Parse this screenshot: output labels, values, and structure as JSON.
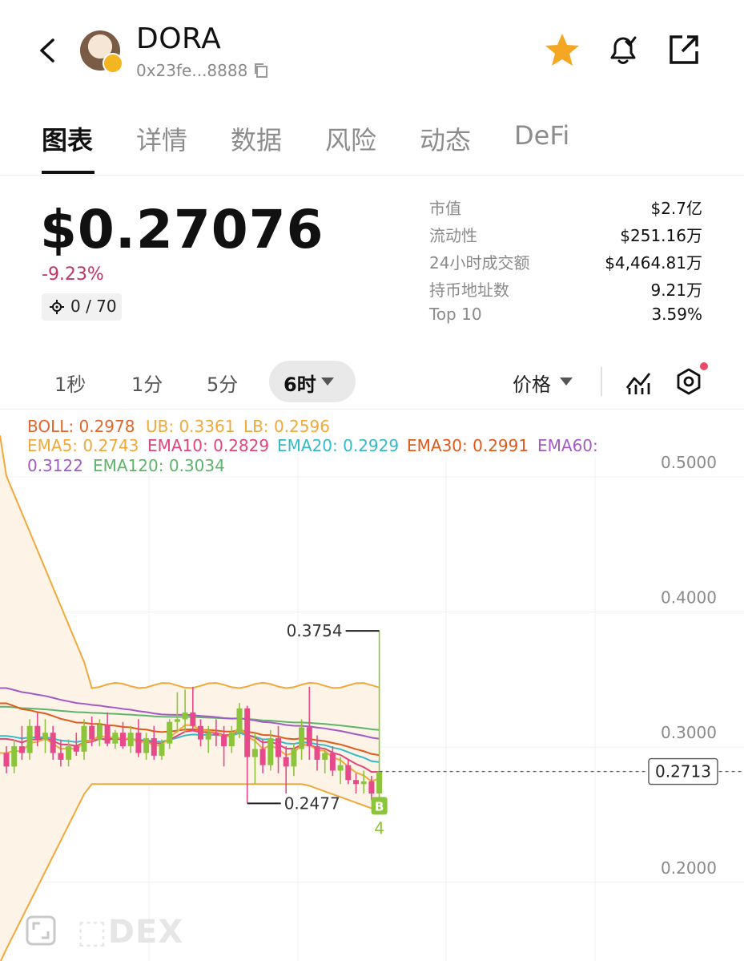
{
  "header": {
    "token_name": "DORA",
    "token_address": "0x23fe...8888",
    "icons": [
      "back-icon",
      "copy-icon",
      "star-icon",
      "bell-icon",
      "share-icon"
    ],
    "star_color": "#f5a623"
  },
  "tabs": [
    {
      "label": "图表",
      "active": true
    },
    {
      "label": "详情"
    },
    {
      "label": "数据"
    },
    {
      "label": "风险"
    },
    {
      "label": "动态"
    },
    {
      "label": "DeFi"
    }
  ],
  "price": {
    "value": "$0.27076",
    "change": "-9.23%",
    "change_color": "#c33362",
    "holders": "0 / 70"
  },
  "stats": [
    {
      "label": "市值",
      "value": "$2.7亿"
    },
    {
      "label": "流动性",
      "value": "$251.16万"
    },
    {
      "label": "24小时成交额",
      "value": "$4,464.81万"
    },
    {
      "label": "持币地址数",
      "value": "9.21万"
    },
    {
      "label": "Top 10",
      "value": "3.59%"
    }
  ],
  "intervals": [
    {
      "label": "1秒"
    },
    {
      "label": "1分"
    },
    {
      "label": "5分"
    },
    {
      "label": "6时",
      "active": true
    }
  ],
  "price_mode": "价格",
  "legend": {
    "boll": "BOLL: 0.2978",
    "ub": "UB: 0.3361",
    "lb": "LB: 0.2596",
    "ema5": "EMA5: 0.2743",
    "ema10": "EMA10: 0.2829",
    "ema20": "EMA20: 0.2929",
    "ema30": "EMA30: 0.2991",
    "ema60_label": "EMA60:",
    "ema60_value": "0.3122",
    "ema120": "EMA120: 0.3034",
    "colors": {
      "boll": "#e0662a",
      "ub": "#f0a93a",
      "lb": "#f0a93a",
      "ema5": "#f0a93a",
      "ema10": "#e0457a",
      "ema20": "#36b9c9",
      "ema30": "#e05a1a",
      "ema60": "#a35bc4",
      "ema120": "#5db56a"
    }
  },
  "chart_data": {
    "type": "candlestick",
    "y_ticks": [
      "0.5000",
      "0.4000",
      "0.3000",
      "0.2000"
    ],
    "ylim": [
      0.18,
      0.52
    ],
    "current_price": "0.2713",
    "high_marker": "0.3754",
    "low_marker": "0.2477",
    "signal_badge": "B",
    "signal_count": "4",
    "candles": [
      {
        "o": 0.285,
        "h": 0.29,
        "l": 0.27,
        "c": 0.275
      },
      {
        "o": 0.275,
        "h": 0.295,
        "l": 0.27,
        "c": 0.29
      },
      {
        "o": 0.29,
        "h": 0.305,
        "l": 0.28,
        "c": 0.285
      },
      {
        "o": 0.285,
        "h": 0.31,
        "l": 0.28,
        "c": 0.305
      },
      {
        "o": 0.305,
        "h": 0.315,
        "l": 0.29,
        "c": 0.295
      },
      {
        "o": 0.295,
        "h": 0.31,
        "l": 0.285,
        "c": 0.3
      },
      {
        "o": 0.3,
        "h": 0.305,
        "l": 0.28,
        "c": 0.285
      },
      {
        "o": 0.285,
        "h": 0.295,
        "l": 0.275,
        "c": 0.28
      },
      {
        "o": 0.28,
        "h": 0.295,
        "l": 0.275,
        "c": 0.29
      },
      {
        "o": 0.29,
        "h": 0.3,
        "l": 0.283,
        "c": 0.286
      },
      {
        "o": 0.286,
        "h": 0.31,
        "l": 0.28,
        "c": 0.305
      },
      {
        "o": 0.305,
        "h": 0.312,
        "l": 0.29,
        "c": 0.295
      },
      {
        "o": 0.295,
        "h": 0.31,
        "l": 0.29,
        "c": 0.306
      },
      {
        "o": 0.306,
        "h": 0.315,
        "l": 0.29,
        "c": 0.292
      },
      {
        "o": 0.292,
        "h": 0.302,
        "l": 0.288,
        "c": 0.3
      },
      {
        "o": 0.3,
        "h": 0.308,
        "l": 0.288,
        "c": 0.29
      },
      {
        "o": 0.29,
        "h": 0.305,
        "l": 0.285,
        "c": 0.3
      },
      {
        "o": 0.3,
        "h": 0.31,
        "l": 0.282,
        "c": 0.285
      },
      {
        "o": 0.285,
        "h": 0.3,
        "l": 0.28,
        "c": 0.296
      },
      {
        "o": 0.296,
        "h": 0.305,
        "l": 0.28,
        "c": 0.283
      },
      {
        "o": 0.283,
        "h": 0.295,
        "l": 0.28,
        "c": 0.292
      },
      {
        "o": 0.292,
        "h": 0.31,
        "l": 0.288,
        "c": 0.308
      },
      {
        "o": 0.308,
        "h": 0.33,
        "l": 0.3,
        "c": 0.31
      },
      {
        "o": 0.31,
        "h": 0.332,
        "l": 0.3,
        "c": 0.315
      },
      {
        "o": 0.315,
        "h": 0.334,
        "l": 0.302,
        "c": 0.305
      },
      {
        "o": 0.305,
        "h": 0.31,
        "l": 0.29,
        "c": 0.295
      },
      {
        "o": 0.295,
        "h": 0.305,
        "l": 0.285,
        "c": 0.3
      },
      {
        "o": 0.3,
        "h": 0.31,
        "l": 0.29,
        "c": 0.298
      },
      {
        "o": 0.298,
        "h": 0.305,
        "l": 0.275,
        "c": 0.29
      },
      {
        "o": 0.29,
        "h": 0.305,
        "l": 0.285,
        "c": 0.3
      },
      {
        "o": 0.3,
        "h": 0.322,
        "l": 0.296,
        "c": 0.318
      },
      {
        "o": 0.318,
        "h": 0.32,
        "l": 0.248,
        "c": 0.282
      },
      {
        "o": 0.282,
        "h": 0.3,
        "l": 0.262,
        "c": 0.288
      },
      {
        "o": 0.288,
        "h": 0.295,
        "l": 0.27,
        "c": 0.276
      },
      {
        "o": 0.276,
        "h": 0.302,
        "l": 0.272,
        "c": 0.296
      },
      {
        "o": 0.296,
        "h": 0.305,
        "l": 0.27,
        "c": 0.282
      },
      {
        "o": 0.282,
        "h": 0.29,
        "l": 0.255,
        "c": 0.275
      },
      {
        "o": 0.275,
        "h": 0.292,
        "l": 0.268,
        "c": 0.288
      },
      {
        "o": 0.288,
        "h": 0.31,
        "l": 0.28,
        "c": 0.304
      },
      {
        "o": 0.304,
        "h": 0.334,
        "l": 0.28,
        "c": 0.29
      },
      {
        "o": 0.29,
        "h": 0.298,
        "l": 0.272,
        "c": 0.28
      },
      {
        "o": 0.28,
        "h": 0.288,
        "l": 0.27,
        "c": 0.285
      },
      {
        "o": 0.285,
        "h": 0.29,
        "l": 0.268,
        "c": 0.272
      },
      {
        "o": 0.272,
        "h": 0.282,
        "l": 0.262,
        "c": 0.276
      },
      {
        "o": 0.276,
        "h": 0.28,
        "l": 0.262,
        "c": 0.265
      },
      {
        "o": 0.265,
        "h": 0.27,
        "l": 0.255,
        "c": 0.262
      },
      {
        "o": 0.262,
        "h": 0.272,
        "l": 0.255,
        "c": 0.264
      },
      {
        "o": 0.264,
        "h": 0.268,
        "l": 0.25,
        "c": 0.255
      },
      {
        "o": 0.255,
        "h": 0.3754,
        "l": 0.25,
        "c": 0.2713
      }
    ]
  }
}
